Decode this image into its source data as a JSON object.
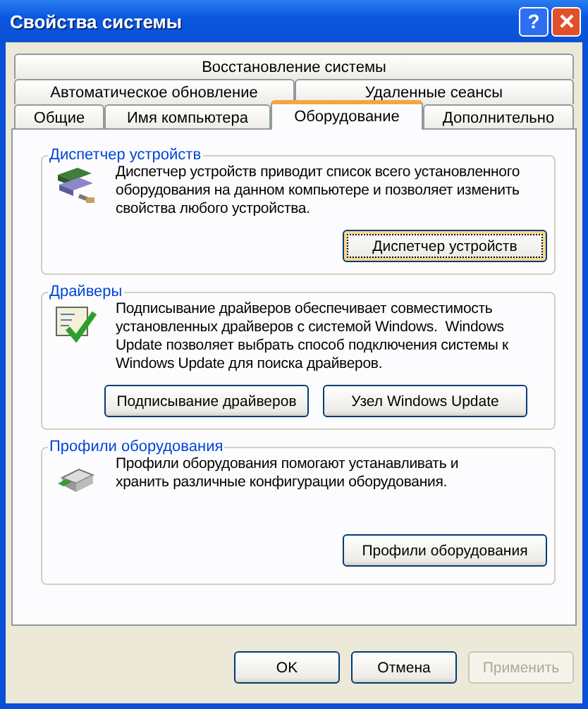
{
  "window": {
    "title": "Свойства системы",
    "help_button": "?"
  },
  "tab_rows": [
    [
      {
        "label": "Восстановление системы",
        "selected": false
      }
    ],
    [
      {
        "label": "Автоматическое обновление",
        "selected": false
      },
      {
        "label": "Удаленные сеансы",
        "selected": false
      }
    ],
    [
      {
        "label": "Общие",
        "selected": false
      },
      {
        "label": "Имя компьютера",
        "selected": false
      },
      {
        "label": "Оборудование",
        "selected": true
      },
      {
        "label": "Дополнительно",
        "selected": false
      }
    ]
  ],
  "groups": [
    {
      "title": "Диспетчер устройств",
      "description": "Диспетчер устройств приводит список всего установленного оборудования на данном компьютере и позволяет изменить свойства любого устройства.",
      "buttons": [
        {
          "label": "Диспетчер устройств",
          "focused": true
        }
      ]
    },
    {
      "title": "Драйверы",
      "description": "Подписывание драйверов обеспечивает совместимость установленных драйверов с системой Windows.  Windows Update позволяет выбрать способ подключения системы к Windows Update для поиска драйверов.",
      "buttons": [
        {
          "label": "Подписывание драйверов",
          "focused": false
        },
        {
          "label": "Узел Windows Update",
          "focused": false
        }
      ]
    },
    {
      "title": "Профили оборудования",
      "description": "Профили оборудования помогают устанавливать и хранить различные конфигурации оборудования.",
      "buttons": [
        {
          "label": "Профили оборудования",
          "focused": false
        }
      ]
    }
  ],
  "dialog_buttons": [
    {
      "label": "OK",
      "disabled": false
    },
    {
      "label": "Отмена",
      "disabled": false
    },
    {
      "label": "Применить",
      "disabled": true
    }
  ]
}
